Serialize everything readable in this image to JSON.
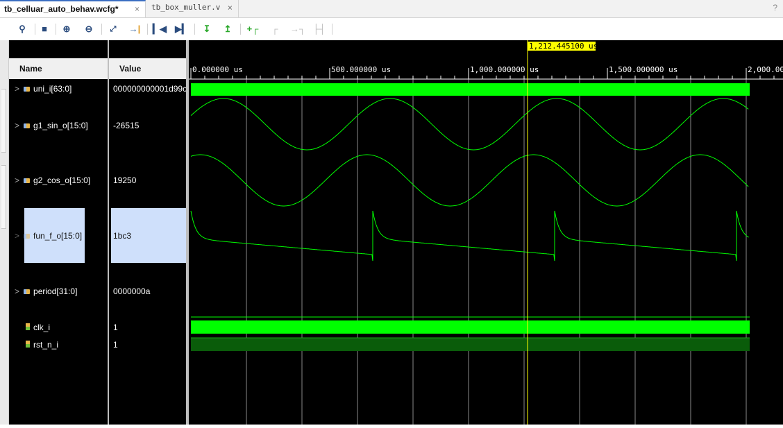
{
  "tabs": [
    {
      "label": "tb_celluar_auto_behav.wcfg*",
      "close": "×"
    },
    {
      "label": "tb_box_muller.v",
      "close": "×"
    }
  ],
  "help_label": "?",
  "toolbar": {
    "icons": [
      "search-icon",
      "save-icon",
      "zoom-in-icon",
      "zoom-out-icon",
      "zoom-fit-icon",
      "go-to-cursor-icon",
      "go-to-start-icon",
      "go-to-end-icon",
      "previous-transition-icon",
      "next-transition-icon",
      "add-marker-icon",
      "previous-marker-icon",
      "next-marker-icon",
      "swap-cursors-icon"
    ]
  },
  "columns": {
    "name": "Name",
    "value": "Value"
  },
  "signals": [
    {
      "name": "uni_i[63:0]",
      "value": "000000000001d99c",
      "expand": ">"
    },
    {
      "name": "g1_sin_o[15:0]",
      "value": "-26515",
      "expand": ">"
    },
    {
      "name": "g2_cos_o[15:0]",
      "value": "19250",
      "expand": ">"
    },
    {
      "name": "fun_f_o[15:0]",
      "value": "1bc3",
      "expand": ">"
    },
    {
      "name": "period[31:0]",
      "value": "0000000a",
      "expand": ">"
    },
    {
      "name": "clk_i",
      "value": "1",
      "expand": ""
    },
    {
      "name": "rst_n_i",
      "value": "1",
      "expand": ""
    }
  ],
  "cursor": {
    "label": "1,212.445100 us",
    "time_us": 1212.4451
  },
  "timeline": {
    "ticks": [
      "0.000000 us",
      "500.000000 us",
      "1,000.000000 us",
      "1,500.000000 us",
      "2,000.00"
    ],
    "tick_values_us": [
      0,
      500,
      1000,
      1500,
      2000
    ]
  },
  "colors": {
    "wave": "#00ff00",
    "cursor": "#ffff00",
    "background": "#000000",
    "selection": "#cfe0fb"
  }
}
